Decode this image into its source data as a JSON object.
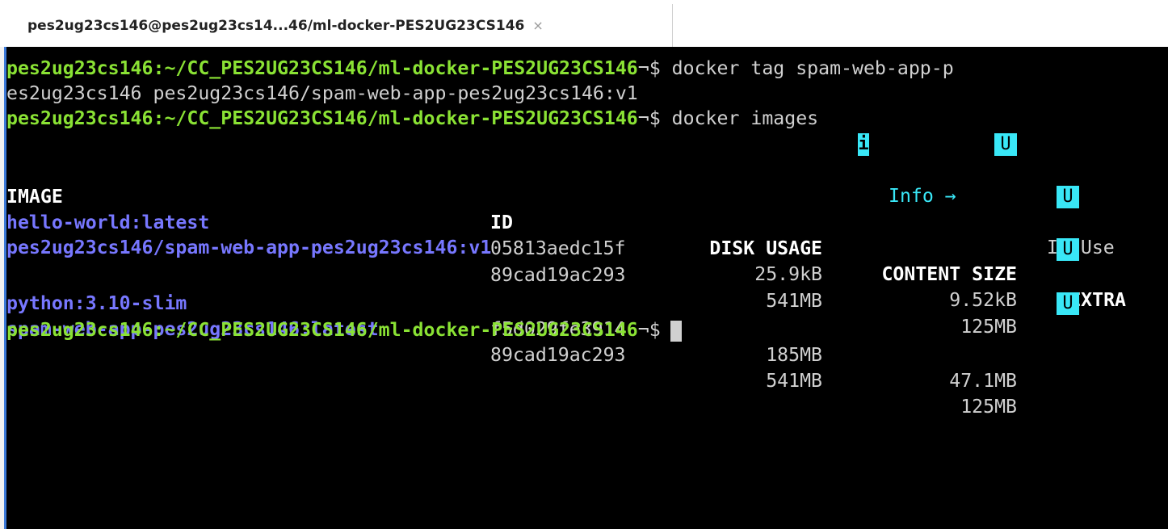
{
  "tab": {
    "title": "pes2ug23cs146@pes2ug23cs14...46/ml-docker-PES2UG23CS146",
    "close_icon": "×"
  },
  "terminal": {
    "prompt": "pes2ug23cs146:~/CC_PES2UG23CS146/ml-docker-PES2UG23CS146",
    "prompt_suffix": "¬$ ",
    "command1_line1": "docker tag spam-web-app-p",
    "command1_line2": "es2ug23cs146 pes2ug23cs146/spam-web-app-pes2ug23cs146:v1",
    "command2": "docker images",
    "legend": {
      "info_icon": "i",
      "info_label": "Info →",
      "u_badge": "U",
      "in_use_label": "In Use"
    },
    "headers": {
      "image": "IMAGE",
      "id": "ID",
      "disk_usage": "DISK USAGE",
      "content_size": "CONTENT SIZE",
      "extra": "EXTRA"
    },
    "rows": [
      {
        "image": "hello-world:latest",
        "id": "05813aedc15f",
        "disk": "25.9kB",
        "content": "9.52kB",
        "extra": "U"
      },
      {
        "image": "pes2ug23cs146/spam-web-app-pes2ug23cs146:v1",
        "id": "89cad19ac293",
        "disk": "541MB",
        "content": "125MB",
        "extra": "U"
      },
      {
        "image": "python:3.10-slim",
        "id": "f5d029fe3914",
        "disk": "185MB",
        "content": "47.1MB",
        "extra": ""
      },
      {
        "image": "spam-web-app-pes2ug23cs146:latest",
        "id": "89cad19ac293",
        "disk": "541MB",
        "content": "125MB",
        "extra": "U"
      }
    ]
  },
  "colors": {
    "prompt": "#8ae234",
    "image_name": "#7777ff",
    "badge": "#39e7f7",
    "background": "#000000"
  }
}
